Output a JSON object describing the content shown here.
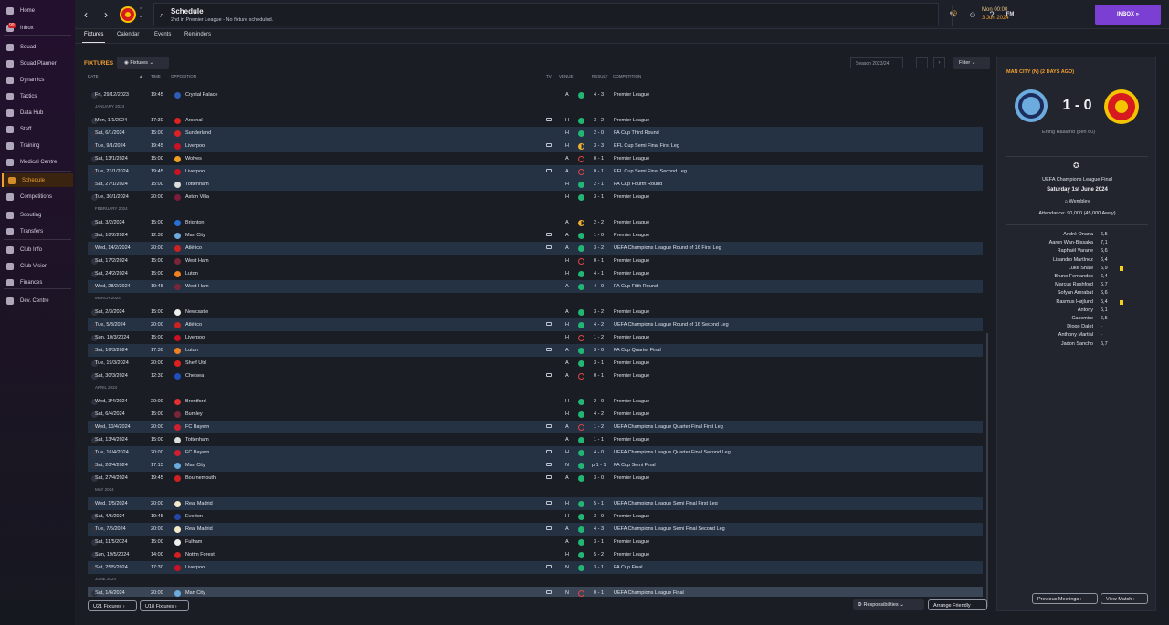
{
  "sidebar": {
    "items": [
      {
        "label": "Home",
        "icon": "home-icon"
      },
      {
        "label": "Inbox",
        "icon": "inbox-icon",
        "badge": "99"
      },
      {
        "label": "Squad",
        "icon": "squad-icon"
      },
      {
        "label": "Squad Planner",
        "icon": "squad-planner-icon"
      },
      {
        "label": "Dynamics",
        "icon": "dynamics-icon"
      },
      {
        "label": "Tactics",
        "icon": "tactics-icon"
      },
      {
        "label": "Data Hub",
        "icon": "data-hub-icon"
      },
      {
        "label": "Staff",
        "icon": "staff-icon"
      },
      {
        "label": "Training",
        "icon": "training-icon"
      },
      {
        "label": "Medical Centre",
        "icon": "medical-icon"
      },
      {
        "label": "Schedule",
        "icon": "schedule-icon",
        "active": true
      },
      {
        "label": "Competitions",
        "icon": "trophy-icon"
      },
      {
        "label": "Scouting",
        "icon": "scouting-icon"
      },
      {
        "label": "Transfers",
        "icon": "transfers-icon"
      },
      {
        "label": "Club Info",
        "icon": "club-info-icon"
      },
      {
        "label": "Club Vision",
        "icon": "club-vision-icon"
      },
      {
        "label": "Finances",
        "icon": "finances-icon"
      },
      {
        "label": "Dev. Centre",
        "icon": "dev-centre-icon"
      }
    ]
  },
  "header": {
    "title": "Schedule",
    "subtitle": "2nd in Premier League - No fixture scheduled.",
    "time": "Mon 00:00",
    "date": "3 Jun 2024",
    "fm_label": "FM",
    "inbox_label": "INBOX"
  },
  "tabs": [
    "Fixtures",
    "Calendar",
    "Events",
    "Reminders"
  ],
  "fixtures": {
    "heading": "FIXTURES",
    "dropdown": "Fixtures",
    "season": "Season 2023/24",
    "filter": "Filter",
    "columns": {
      "date": "DATE",
      "time": "TIME",
      "opposition": "OPPOSITION",
      "tv": "TV",
      "venue": "VENUE",
      "result": "RESULT",
      "competition": "COMPETITION"
    },
    "rows": [
      {
        "type": "match",
        "date": "Fri, 29/12/2023",
        "time": "19:45",
        "opp": "Crystal Palace",
        "tv": false,
        "venue": "A",
        "res": "W",
        "score": "4 - 3",
        "comp": "Premier League",
        "cup": false,
        "oppc": "#2d5bb8"
      },
      {
        "type": "month",
        "label": "JANUARY 2024"
      },
      {
        "type": "match",
        "date": "Mon, 1/1/2024",
        "time": "17:30",
        "opp": "Arsenal",
        "tv": true,
        "venue": "H",
        "res": "W",
        "score": "3 - 2",
        "comp": "Premier League",
        "cup": false,
        "oppc": "#d22"
      },
      {
        "type": "match",
        "date": "Sat, 6/1/2024",
        "time": "15:00",
        "opp": "Sunderland",
        "tv": false,
        "venue": "H",
        "res": "W",
        "score": "2 - 0",
        "comp": "FA Cup Third Round",
        "cup": true,
        "oppc": "#d22"
      },
      {
        "type": "match",
        "date": "Tue, 9/1/2024",
        "time": "19:45",
        "opp": "Liverpool",
        "tv": true,
        "venue": "H",
        "res": "D",
        "score": "3 - 3",
        "comp": "EFL Cup Semi Final First Leg",
        "cup": true,
        "oppc": "#c12"
      },
      {
        "type": "match",
        "date": "Sat, 13/1/2024",
        "time": "15:00",
        "opp": "Wolves",
        "tv": false,
        "venue": "A",
        "res": "L",
        "score": "0 - 1",
        "comp": "Premier League",
        "cup": false,
        "oppc": "#f0a020"
      },
      {
        "type": "match",
        "date": "Tue, 23/1/2024",
        "time": "19:45",
        "opp": "Liverpool",
        "tv": true,
        "venue": "A",
        "res": "L",
        "score": "0 - 1",
        "comp": "EFL Cup Semi Final Second Leg",
        "cup": true,
        "oppc": "#c12"
      },
      {
        "type": "match",
        "date": "Sat, 27/1/2024",
        "time": "15:00",
        "opp": "Tottenham",
        "tv": false,
        "venue": "H",
        "res": "W",
        "score": "2 - 1",
        "comp": "FA Cup Fourth Round",
        "cup": true,
        "oppc": "#ddd"
      },
      {
        "type": "match",
        "date": "Tue, 30/1/2024",
        "time": "20:00",
        "opp": "Aston Villa",
        "tv": false,
        "venue": "H",
        "res": "W",
        "score": "3 - 1",
        "comp": "Premier League",
        "cup": false,
        "oppc": "#7a1c3a"
      },
      {
        "type": "month",
        "label": "FEBRUARY 2024"
      },
      {
        "type": "match",
        "date": "Sat, 3/2/2024",
        "time": "15:00",
        "opp": "Brighton",
        "tv": false,
        "venue": "A",
        "res": "D",
        "score": "2 - 2",
        "comp": "Premier League",
        "cup": false,
        "oppc": "#2a6fd4"
      },
      {
        "type": "match",
        "date": "Sat, 10/2/2024",
        "time": "12:30",
        "opp": "Man City",
        "tv": true,
        "venue": "A",
        "res": "W",
        "score": "1 - 0",
        "comp": "Premier League",
        "cup": false,
        "oppc": "#6cabdd"
      },
      {
        "type": "match",
        "date": "Wed, 14/2/2024",
        "time": "20:00",
        "opp": "Atlético",
        "tv": true,
        "venue": "A",
        "res": "W",
        "score": "3 - 2",
        "comp": "UEFA Champions League Round of 16 First Leg",
        "cup": true,
        "oppc": "#c22"
      },
      {
        "type": "match",
        "date": "Sat, 17/2/2024",
        "time": "15:00",
        "opp": "West Ham",
        "tv": false,
        "venue": "H",
        "res": "L",
        "score": "0 - 1",
        "comp": "Premier League",
        "cup": false,
        "oppc": "#7a2638"
      },
      {
        "type": "match",
        "date": "Sat, 24/2/2024",
        "time": "15:00",
        "opp": "Luton",
        "tv": false,
        "venue": "H",
        "res": "W",
        "score": "4 - 1",
        "comp": "Premier League",
        "cup": false,
        "oppc": "#f08020"
      },
      {
        "type": "match",
        "date": "Wed, 28/2/2024",
        "time": "19:45",
        "opp": "West Ham",
        "tv": false,
        "venue": "A",
        "res": "W",
        "score": "4 - 0",
        "comp": "FA Cup Fifth Round",
        "cup": true,
        "oppc": "#7a2638"
      },
      {
        "type": "month",
        "label": "MARCH 2024"
      },
      {
        "type": "match",
        "date": "Sat, 2/3/2024",
        "time": "15:00",
        "opp": "Newcastle",
        "tv": false,
        "venue": "A",
        "res": "W",
        "score": "3 - 2",
        "comp": "Premier League",
        "cup": false,
        "oppc": "#eee"
      },
      {
        "type": "match",
        "date": "Tue, 5/3/2024",
        "time": "20:00",
        "opp": "Atlético",
        "tv": true,
        "venue": "H",
        "res": "W",
        "score": "4 - 2",
        "comp": "UEFA Champions League Round of 16 Second Leg",
        "cup": true,
        "oppc": "#c22"
      },
      {
        "type": "match",
        "date": "Sun, 10/3/2024",
        "time": "15:00",
        "opp": "Liverpool",
        "tv": false,
        "venue": "H",
        "res": "L",
        "score": "1 - 2",
        "comp": "Premier League",
        "cup": false,
        "oppc": "#c12"
      },
      {
        "type": "match",
        "date": "Sat, 16/3/2024",
        "time": "17:30",
        "opp": "Luton",
        "tv": true,
        "venue": "A",
        "res": "W",
        "score": "3 - 0",
        "comp": "FA Cup Quarter Final",
        "cup": true,
        "oppc": "#f08020"
      },
      {
        "type": "match",
        "date": "Tue, 19/3/2024",
        "time": "20:00",
        "opp": "Sheff Utd",
        "tv": false,
        "venue": "A",
        "res": "W",
        "score": "3 - 1",
        "comp": "Premier League",
        "cup": false,
        "oppc": "#e02020"
      },
      {
        "type": "match",
        "date": "Sat, 30/3/2024",
        "time": "12:30",
        "opp": "Chelsea",
        "tv": true,
        "venue": "A",
        "res": "L",
        "score": "0 - 1",
        "comp": "Premier League",
        "cup": false,
        "oppc": "#1f4fbf"
      },
      {
        "type": "month",
        "label": "APRIL 2024"
      },
      {
        "type": "match",
        "date": "Wed, 3/4/2024",
        "time": "20:00",
        "opp": "Brentford",
        "tv": false,
        "venue": "H",
        "res": "W",
        "score": "2 - 0",
        "comp": "Premier League",
        "cup": false,
        "oppc": "#e03030"
      },
      {
        "type": "match",
        "date": "Sat, 6/4/2024",
        "time": "15:00",
        "opp": "Burnley",
        "tv": false,
        "venue": "H",
        "res": "W",
        "score": "4 - 2",
        "comp": "Premier League",
        "cup": false,
        "oppc": "#7a2638"
      },
      {
        "type": "match",
        "date": "Wed, 10/4/2024",
        "time": "20:00",
        "opp": "FC Bayern",
        "tv": true,
        "venue": "A",
        "res": "L",
        "score": "1 - 2",
        "comp": "UEFA Champions League Quarter Final First Leg",
        "cup": true,
        "oppc": "#d02030"
      },
      {
        "type": "match",
        "date": "Sat, 13/4/2024",
        "time": "15:00",
        "opp": "Tottenham",
        "tv": false,
        "venue": "A",
        "res": "W",
        "score": "1 - 1",
        "comp": "Premier League",
        "cup": false,
        "oppc": "#ddd"
      },
      {
        "type": "match",
        "date": "Tue, 16/4/2024",
        "time": "20:00",
        "opp": "FC Bayern",
        "tv": true,
        "venue": "H",
        "res": "W",
        "score": "4 - 0",
        "comp": "UEFA Champions League Quarter Final Second Leg",
        "cup": true,
        "oppc": "#d02030"
      },
      {
        "type": "match",
        "date": "Sat, 20/4/2024",
        "time": "17:15",
        "opp": "Man City",
        "tv": true,
        "venue": "N",
        "res": "W",
        "score": "p 1 - 1",
        "comp": "FA Cup Semi Final",
        "cup": true,
        "oppc": "#6cabdd"
      },
      {
        "type": "match",
        "date": "Sat, 27/4/2024",
        "time": "19:45",
        "opp": "Bournemouth",
        "tv": true,
        "venue": "A",
        "res": "W",
        "score": "3 - 0",
        "comp": "Premier League",
        "cup": false,
        "oppc": "#d02020"
      },
      {
        "type": "month",
        "label": "MAY 2024"
      },
      {
        "type": "match",
        "date": "Wed, 1/5/2024",
        "time": "20:00",
        "opp": "Real Madrid",
        "tv": true,
        "venue": "H",
        "res": "W",
        "score": "5 - 1",
        "comp": "UEFA Champions League Semi Final First Leg",
        "cup": true,
        "oppc": "#f4e9c8"
      },
      {
        "type": "match",
        "date": "Sat, 4/5/2024",
        "time": "19:45",
        "opp": "Everton",
        "tv": false,
        "venue": "H",
        "res": "W",
        "score": "3 - 0",
        "comp": "Premier League",
        "cup": false,
        "oppc": "#2446a8"
      },
      {
        "type": "match",
        "date": "Tue, 7/5/2024",
        "time": "20:00",
        "opp": "Real Madrid",
        "tv": true,
        "venue": "A",
        "res": "W",
        "score": "4 - 3",
        "comp": "UEFA Champions League Semi Final Second Leg",
        "cup": true,
        "oppc": "#f4e9c8"
      },
      {
        "type": "match",
        "date": "Sat, 11/5/2024",
        "time": "15:00",
        "opp": "Fulham",
        "tv": false,
        "venue": "A",
        "res": "W",
        "score": "3 - 1",
        "comp": "Premier League",
        "cup": false,
        "oppc": "#eee"
      },
      {
        "type": "match",
        "date": "Sun, 19/5/2024",
        "time": "14:00",
        "opp": "Nottm Forest",
        "tv": false,
        "venue": "H",
        "res": "W",
        "score": "5 - 2",
        "comp": "Premier League",
        "cup": false,
        "oppc": "#d02020"
      },
      {
        "type": "match",
        "date": "Sat, 25/5/2024",
        "time": "17:30",
        "opp": "Liverpool",
        "tv": true,
        "venue": "N",
        "res": "W",
        "score": "3 - 1",
        "comp": "FA Cup Final",
        "cup": true,
        "oppc": "#c12"
      },
      {
        "type": "month",
        "label": "JUNE 2024"
      },
      {
        "type": "match",
        "date": "Sat, 1/6/2024",
        "time": "20:00",
        "opp": "Man City",
        "tv": true,
        "venue": "N",
        "res": "L",
        "score": "0 - 1",
        "comp": "UEFA Champions League Final",
        "cup": true,
        "sel": true,
        "oppc": "#6cabdd"
      }
    ],
    "u21": "U21 Fixtures",
    "u18": "U18 Fixtures",
    "responsibilities": "Responsibilities",
    "arrange": "Arrange Friendly"
  },
  "panel": {
    "title": "MAN CITY (N) (2 DAYS AGO)",
    "score": "1 - 0",
    "scorer": "Erling Haaland (pen 60)",
    "competition": "UEFA Champions League Final",
    "date": "Saturday 1st June 2024",
    "venue": "Wembley",
    "attendance": "Attendance: 90,000 (45,000 Away)",
    "players": [
      {
        "name": "André Onana",
        "rating": "6,5"
      },
      {
        "name": "Aaron Wan-Bissaka",
        "rating": "7,1"
      },
      {
        "name": "Raphaël Varane",
        "rating": "6,6"
      },
      {
        "name": "Lisandro Martínez",
        "rating": "6,4"
      },
      {
        "name": "Luke Shaw",
        "rating": "6,9",
        "yellow": true
      },
      {
        "name": "Bruno Fernandes",
        "rating": "6,4"
      },
      {
        "name": "Marcus Rashford",
        "rating": "6,7"
      },
      {
        "name": "Sofyan Amrabat",
        "rating": "6,6"
      },
      {
        "name": "Rasmus Højlund",
        "rating": "6,4",
        "yellow": true
      },
      {
        "name": "Antony",
        "rating": "6,1"
      },
      {
        "name": "Casemiro",
        "rating": "6,5"
      },
      {
        "name": "Diogo Dalot",
        "rating": "-"
      },
      {
        "name": "Anthony Martial",
        "rating": "-"
      },
      {
        "name": "Jadon Sancho",
        "rating": "6,7"
      }
    ],
    "prev_meetings": "Previous Meetings",
    "view_match": "View Match"
  },
  "colors": {
    "accent": "#f0a030",
    "inbox": "#7b3fd4",
    "win": "#22b573",
    "loss": "#e04545",
    "draw": "#f0b030"
  }
}
